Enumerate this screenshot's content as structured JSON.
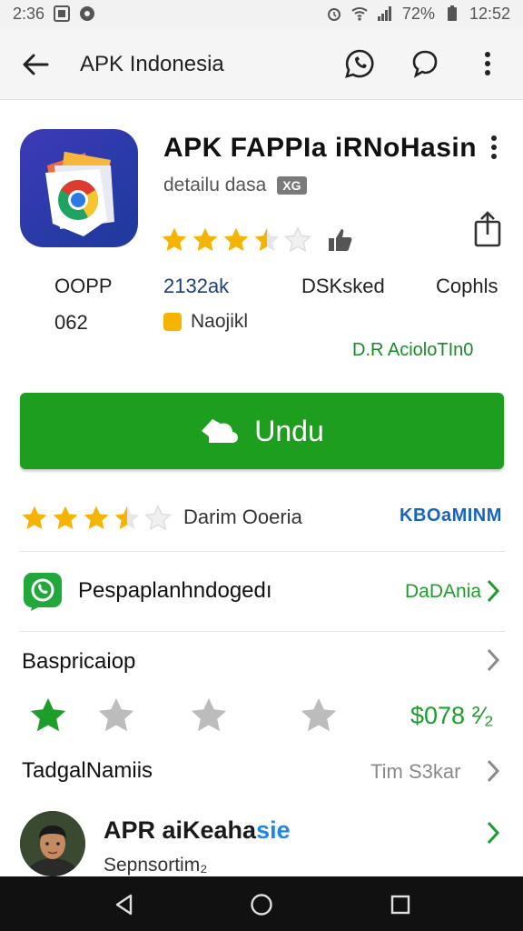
{
  "status_bar": {
    "time_left": "2:36",
    "battery_text": "72%",
    "time_right": "12:52"
  },
  "app_bar": {
    "title": "APK Indonesia",
    "back_icon": "back-arrow-icon",
    "actions": [
      "whatsapp-icon",
      "chat-bubble-icon",
      "more-vert-icon"
    ]
  },
  "app": {
    "name": "APK FAPPIa iRNoHasin",
    "developer": "detailu dasa",
    "developer_badge": "XG",
    "rating_stars": 3.5,
    "stats": [
      {
        "label": "OOPP",
        "value": "062"
      },
      {
        "label": "2132ak"
      },
      {
        "label": "DSKsked"
      },
      {
        "label": "Cophls"
      }
    ],
    "badge_text": "Naojikl",
    "age_rating": "D.R AcioloTIn0"
  },
  "install_button": {
    "label": "Undu"
  },
  "rating_row": {
    "stars": 3.5,
    "label": "Darim Ooeria",
    "link": "KBOaMINM"
  },
  "whatsapp_row": {
    "label": "Pespaplanhndogedı",
    "link": "DaDAnia"
  },
  "description_row": {
    "label": "Baspricaiop",
    "stars_filled": [
      true,
      false,
      false,
      false
    ],
    "price": "$078 ²⁄₂"
  },
  "tags_row": {
    "label": "TadgalNamiis",
    "link": "Tim S3kar"
  },
  "publisher_row": {
    "name_part1": "APR aiKeaha",
    "name_part2": "sie",
    "subtitle": "Sepnsortim₂"
  },
  "colors": {
    "install_green": "#1e9e1e",
    "star_gold": "#f5b400",
    "link_blue": "#1565c0",
    "link_green": "#1d9e2a"
  }
}
